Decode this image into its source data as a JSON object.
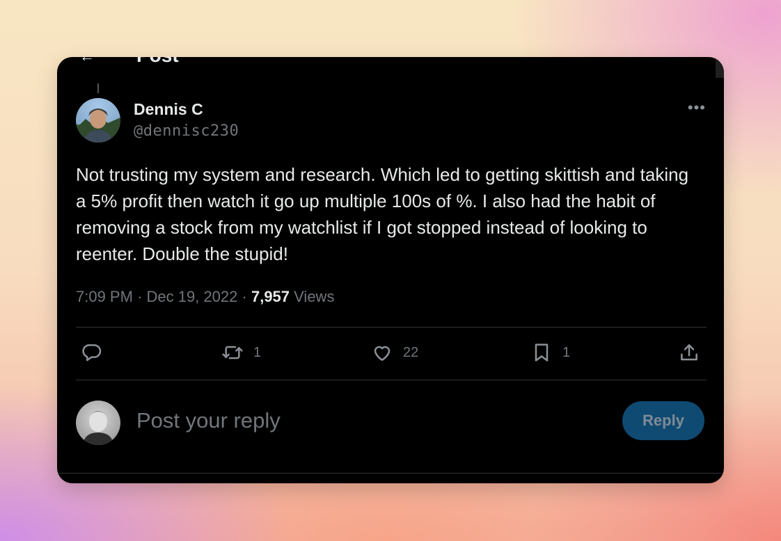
{
  "header": {
    "back_icon": "arrow-left-icon",
    "title": "Post"
  },
  "tweet": {
    "author_name": "Dennis C",
    "author_handle": "@dennisc230",
    "text": "Not trusting my system and research. Which led to getting skittish and taking a 5% profit then watch it go up multiple 100s of %. I also had the habit of removing a stock from my watchlist if I got stopped instead of looking to reenter. Double the stupid!",
    "time": "7:09 PM",
    "separator": "·",
    "date": "Dec 19, 2022",
    "views_count": "7,957",
    "views_label": "Views",
    "more_icon": "more-icon"
  },
  "actions": {
    "reply": {
      "icon": "reply-icon",
      "count": ""
    },
    "retweet": {
      "icon": "retweet-icon",
      "count": "1"
    },
    "like": {
      "icon": "heart-icon",
      "count": "22"
    },
    "bookmark": {
      "icon": "bookmark-icon",
      "count": "1"
    },
    "share": {
      "icon": "share-icon"
    }
  },
  "reply_box": {
    "placeholder": "Post your reply",
    "button_label": "Reply"
  },
  "colors": {
    "background": "#000000",
    "text_primary": "#e7e9ea",
    "text_secondary": "#71767b",
    "divider": "#2f3336",
    "reply_button_bg": "#0f4a72"
  }
}
